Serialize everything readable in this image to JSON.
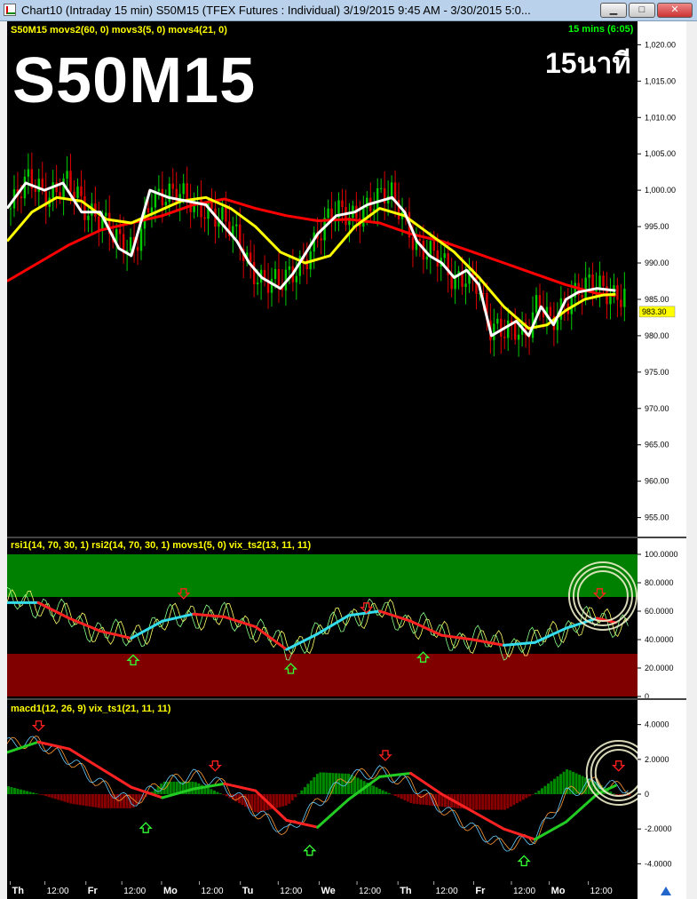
{
  "window": {
    "title": "Chart10 (Intraday 15 min)  S50M15 (TFEX Futures : Individual) 3/19/2015 9:45 AM - 3/30/2015 5:0...",
    "btn_min": "▁",
    "btn_max": "□",
    "btn_close": "✕"
  },
  "price_panel": {
    "header": "S50M15 movs2(60, 0) movs3(5, 0) movs4(21, 0)",
    "symbol_overlay": "S50M15",
    "timeframe_overlay": "15นาที",
    "interval_label": "15 mins (6:05)",
    "last_price_label": "983.30"
  },
  "rsi_panel": {
    "header": "rsi1(14, 70, 30, 1) rsi2(14, 70, 30, 1) movs1(5, 0) vix_ts2(13, 11, 11)"
  },
  "macd_panel": {
    "header": "macd1(12, 26, 9) vix_ts1(21, 11, 11)"
  },
  "colors": {
    "candle_up": "#00cc00",
    "candle_down": "#dd0000",
    "ma_fast": "#ffffff",
    "ma_mid": "#ffff00",
    "ma_slow": "#ff0000",
    "overbought_zone": "#008000",
    "oversold_zone": "#800000",
    "signal_cyan": "#33ddee"
  },
  "chart_data": [
    {
      "type": "line",
      "name_ref": "price",
      "x_range": [
        0,
        1
      ],
      "y_ticks": [
        "1,020.00",
        "1,015.00",
        "1,010.00",
        "1,005.00",
        "1,000.00",
        "995.00",
        "990.00",
        "985.00",
        "980.00",
        "975.00",
        "970.00",
        "965.00",
        "960.00",
        "955.00"
      ],
      "ylim": [
        953,
        1022
      ],
      "series": [
        {
          "name": "movs2(60, 0)",
          "color": "#ff0000",
          "x": [
            0,
            0.05,
            0.1,
            0.15,
            0.2,
            0.25,
            0.3,
            0.35,
            0.4,
            0.45,
            0.5,
            0.55,
            0.6,
            0.65,
            0.7,
            0.75,
            0.8,
            0.85,
            0.9,
            0.95,
            0.98
          ],
          "values": [
            987.5,
            990,
            992.5,
            994.5,
            995.5,
            996.5,
            998,
            998.8,
            997.5,
            996.5,
            995.8,
            996,
            995.5,
            994,
            993,
            991.5,
            990,
            988.5,
            987,
            985.8,
            985.5
          ]
        },
        {
          "name": "movs3(5, 0)",
          "color": "#ffffff",
          "x": [
            0,
            0.03,
            0.06,
            0.09,
            0.12,
            0.15,
            0.18,
            0.2,
            0.23,
            0.26,
            0.29,
            0.32,
            0.35,
            0.37,
            0.39,
            0.41,
            0.44,
            0.46,
            0.5,
            0.53,
            0.56,
            0.58,
            0.6,
            0.62,
            0.64,
            0.66,
            0.68,
            0.7,
            0.72,
            0.74,
            0.76,
            0.78,
            0.8,
            0.82,
            0.84,
            0.86,
            0.88,
            0.9,
            0.92,
            0.95,
            0.98
          ],
          "values": [
            997.5,
            1001,
            1000,
            1001,
            997,
            997,
            992,
            991,
            1000,
            999,
            998.5,
            998,
            995,
            993,
            990,
            988,
            986.5,
            988.5,
            994,
            996.5,
            997,
            998,
            998.5,
            999,
            997,
            993,
            991,
            990,
            988,
            989,
            987,
            980,
            981,
            982,
            980,
            984,
            981.5,
            985,
            986,
            986.5,
            986.2
          ]
        },
        {
          "name": "movs4(21, 0)",
          "color": "#ffff00",
          "x": [
            0,
            0.04,
            0.08,
            0.12,
            0.16,
            0.2,
            0.24,
            0.28,
            0.32,
            0.36,
            0.4,
            0.44,
            0.48,
            0.52,
            0.56,
            0.6,
            0.64,
            0.68,
            0.72,
            0.76,
            0.8,
            0.84,
            0.87,
            0.9,
            0.93,
            0.96,
            0.98
          ],
          "values": [
            993,
            997,
            999,
            998.5,
            996,
            995.5,
            997,
            998.5,
            999,
            997.5,
            995,
            991.5,
            990,
            991,
            995,
            997.5,
            996.5,
            994,
            991.5,
            988,
            984,
            981,
            981.5,
            983.5,
            985,
            985.6,
            985.7
          ]
        }
      ],
      "last_price": 983.3
    },
    {
      "type": "area",
      "name_ref": "rsi",
      "y_ticks": [
        "100.0000",
        "80.0000",
        "60.0000",
        "40.0000",
        "20.0000",
        "0"
      ],
      "ylim": [
        0,
        100
      ],
      "zones": [
        {
          "from": 70,
          "to": 100,
          "color": "#008000"
        },
        {
          "from": 0,
          "to": 30,
          "color": "#800000"
        }
      ],
      "series": [
        {
          "name": "vix_ts2(13, 11, 11)",
          "x": [
            0,
            0.05,
            0.1,
            0.15,
            0.2,
            0.25,
            0.3,
            0.35,
            0.4,
            0.45,
            0.5,
            0.55,
            0.6,
            0.65,
            0.7,
            0.75,
            0.8,
            0.85,
            0.9,
            0.95,
            0.98
          ],
          "values": [
            66,
            66,
            55,
            46,
            41,
            53,
            58,
            56,
            49,
            33,
            44,
            57,
            60,
            53,
            43,
            40,
            36,
            38,
            48,
            55,
            52
          ]
        }
      ]
    },
    {
      "type": "line",
      "name_ref": "macd",
      "y_ticks": [
        "4.0000",
        "2.0000",
        "0",
        "-2.0000",
        "-4.0000"
      ],
      "ylim": [
        -4.8,
        4.8
      ],
      "series": [
        {
          "name": "vix_ts1(21, 11, 11)",
          "x": [
            0,
            0.05,
            0.1,
            0.15,
            0.2,
            0.25,
            0.3,
            0.35,
            0.4,
            0.45,
            0.5,
            0.55,
            0.6,
            0.65,
            0.7,
            0.75,
            0.8,
            0.85,
            0.9,
            0.95,
            0.98
          ],
          "values": [
            2.4,
            3,
            2.6,
            1.5,
            0.4,
            -0.2,
            0.3,
            0.6,
            0.2,
            -1.5,
            -1.9,
            -0.3,
            1,
            1.2,
            0,
            -1,
            -2,
            -2.6,
            -1.6,
            0,
            0.5
          ]
        },
        {
          "name": "macd1(12, 26, 9)",
          "x": [
            0,
            0.05,
            0.1,
            0.15,
            0.2,
            0.25,
            0.3,
            0.35,
            0.4,
            0.45,
            0.5,
            0.55,
            0.6,
            0.65,
            0.7,
            0.75,
            0.8,
            0.85,
            0.9,
            0.95,
            0.98
          ],
          "values": [
            2.9,
            3,
            2,
            0.6,
            -0.5,
            0.6,
            1.1,
            0.5,
            -1,
            -2.2,
            -0.5,
            1,
            1.3,
            0.6,
            -0.8,
            -2,
            -3,
            -2.5,
            0,
            0.7,
            0.4
          ]
        }
      ]
    }
  ],
  "x_axis_ticks": [
    {
      "label": "Th",
      "pos": 0.005,
      "bold": true
    },
    {
      "label": "12:00",
      "pos": 0.06,
      "bold": false
    },
    {
      "label": "Fr",
      "pos": 0.125,
      "bold": true
    },
    {
      "label": "12:00",
      "pos": 0.182,
      "bold": false
    },
    {
      "label": "Mo",
      "pos": 0.245,
      "bold": true
    },
    {
      "label": "12:00",
      "pos": 0.305,
      "bold": false
    },
    {
      "label": "Tu",
      "pos": 0.37,
      "bold": true
    },
    {
      "label": "12:00",
      "pos": 0.43,
      "bold": false
    },
    {
      "label": "We",
      "pos": 0.495,
      "bold": true
    },
    {
      "label": "12:00",
      "pos": 0.555,
      "bold": false
    },
    {
      "label": "Th",
      "pos": 0.62,
      "bold": true
    },
    {
      "label": "12:00",
      "pos": 0.677,
      "bold": false
    },
    {
      "label": "Fr",
      "pos": 0.74,
      "bold": true
    },
    {
      "label": "12:00",
      "pos": 0.8,
      "bold": false
    },
    {
      "label": "Mo",
      "pos": 0.86,
      "bold": true
    },
    {
      "label": "12:00",
      "pos": 0.922,
      "bold": false
    }
  ]
}
